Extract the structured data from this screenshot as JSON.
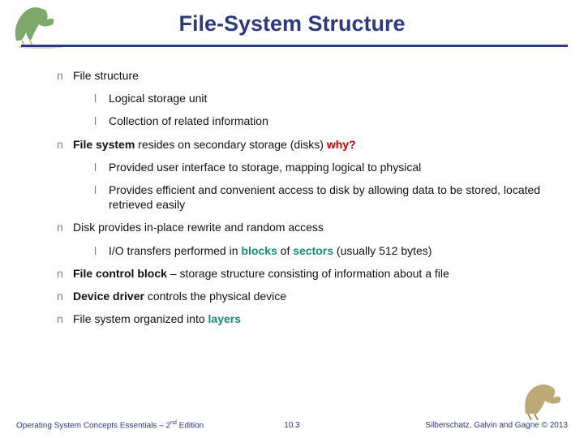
{
  "title": "File-System Structure",
  "bullets": [
    {
      "runs": [
        {
          "t": "File structure"
        }
      ],
      "sub": [
        {
          "runs": [
            {
              "t": "Logical storage unit"
            }
          ]
        },
        {
          "runs": [
            {
              "t": "Collection of related information"
            }
          ]
        }
      ]
    },
    {
      "runs": [
        {
          "t": "File system",
          "cls": "bold"
        },
        {
          "t": " resides on secondary storage (disks) "
        },
        {
          "t": "why?",
          "cls": "bold red"
        }
      ],
      "sub": [
        {
          "runs": [
            {
              "t": "Provided user interface to storage, mapping logical to physical"
            }
          ]
        },
        {
          "runs": [
            {
              "t": "Provides efficient and convenient access to disk by allowing data to be stored, located retrieved easily"
            }
          ]
        }
      ]
    },
    {
      "runs": [
        {
          "t": "Disk provides in-place rewrite and random access"
        }
      ],
      "sub": [
        {
          "runs": [
            {
              "t": "I/O transfers performed in "
            },
            {
              "t": "blocks",
              "cls": "teal"
            },
            {
              "t": " of "
            },
            {
              "t": "sectors",
              "cls": "teal"
            },
            {
              "t": " (usually 512 bytes)"
            }
          ]
        }
      ]
    },
    {
      "runs": [
        {
          "t": "File control block",
          "cls": "bold"
        },
        {
          "t": " – storage structure consisting of information about a file"
        }
      ]
    },
    {
      "runs": [
        {
          "t": "Device driver",
          "cls": "bold"
        },
        {
          "t": " controls the physical device"
        }
      ]
    },
    {
      "runs": [
        {
          "t": "File system organized into "
        },
        {
          "t": "layers",
          "cls": "teal"
        }
      ]
    }
  ],
  "footer": {
    "left_a": "Operating System Concepts Essentials – 2",
    "left_sup": "nd",
    "left_b": " Edition",
    "center": "10.3",
    "right": "Silberschatz, Galvin and Gagne © 2013"
  },
  "markers": {
    "lv1": "n",
    "lv2": "l"
  }
}
